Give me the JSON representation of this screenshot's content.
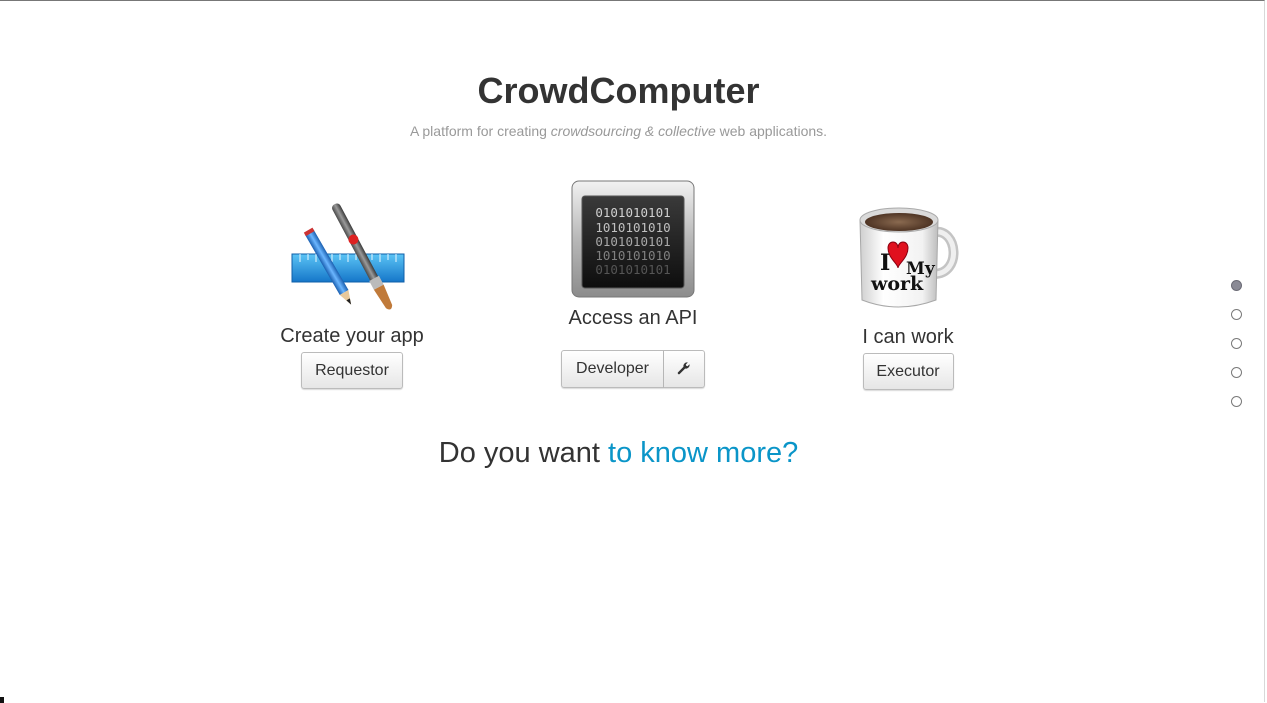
{
  "header": {
    "title": "CrowdComputer",
    "subtitle_prefix": "A platform for creating ",
    "subtitle_em": "crowdsourcing & collective",
    "subtitle_suffix": " web applications."
  },
  "cards": [
    {
      "label": "Create your app",
      "button": "Requestor",
      "icon": "app-design-icon"
    },
    {
      "label": "Access an API",
      "button": "Developer",
      "icon": "binary-terminal-icon",
      "secondary_icon": "wrench-icon"
    },
    {
      "label": "I can work",
      "button": "Executor",
      "icon": "coffee-mug-icon"
    }
  ],
  "binary_text": [
    "0101010101",
    "1010101010",
    "0101010101",
    "1010101010",
    "0101010101"
  ],
  "mug_text": {
    "line1": "I",
    "line2": "My",
    "line3": "work"
  },
  "more": {
    "prefix": "Do you want ",
    "link": "to know more?"
  },
  "pagination": {
    "count": 5,
    "active": 1
  },
  "colors": {
    "link": "#0a95c8",
    "text": "#333333",
    "muted": "#999999"
  }
}
